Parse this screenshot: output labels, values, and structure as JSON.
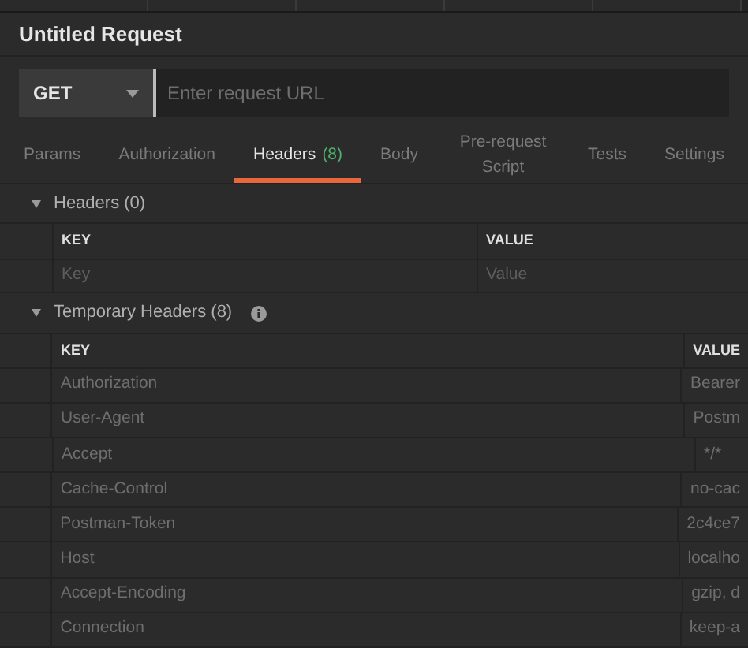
{
  "title": "Untitled Request",
  "request": {
    "method": "GET",
    "url_placeholder": "Enter request URL"
  },
  "tabs": [
    {
      "label": "Params",
      "selected": false
    },
    {
      "label": "Authorization",
      "selected": false
    },
    {
      "label": "Headers",
      "count": "(8)",
      "selected": true
    },
    {
      "label": "Body",
      "selected": false
    },
    {
      "label": "Pre-request Script",
      "selected": false
    },
    {
      "label": "Tests",
      "selected": false
    },
    {
      "label": "Settings",
      "selected": false
    }
  ],
  "headers": {
    "title": "Headers (0)",
    "expanded": true,
    "columns": [
      "KEY",
      "VALUE"
    ],
    "key_placeholder": "Key",
    "value_placeholder": "Value"
  },
  "temporary_headers": {
    "title": "Temporary Headers (8)",
    "expanded": true,
    "columns": [
      "KEY",
      "VALUE"
    ],
    "rows": [
      {
        "key": "Authorization",
        "value": "Bearer"
      },
      {
        "key": "User-Agent",
        "value": "Postm"
      },
      {
        "key": "Accept",
        "value": "*/*"
      },
      {
        "key": "Cache-Control",
        "value": "no-cac"
      },
      {
        "key": "Postman-Token",
        "value": "2c4ce7"
      },
      {
        "key": "Host",
        "value": "localho"
      },
      {
        "key": "Accept-Encoding",
        "value": "gzip, d"
      },
      {
        "key": "Connection",
        "value": "keep-a"
      }
    ]
  }
}
